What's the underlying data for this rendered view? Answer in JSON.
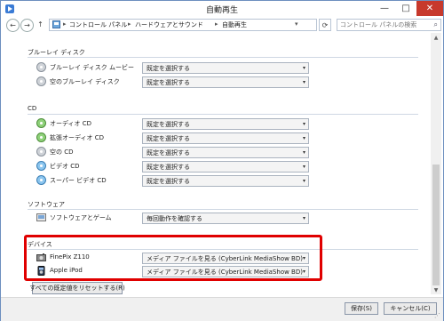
{
  "window": {
    "title": "自動再生"
  },
  "titlebar_buttons": {
    "min": "—",
    "max": "□",
    "close": "✕"
  },
  "nav": {
    "back": "←",
    "forward": "→",
    "up": "↑",
    "breadcrumbs": [
      "コントロール パネル",
      "ハードウェアとサウンド",
      "自動再生"
    ],
    "refresh": "⟳",
    "search_placeholder": "コントロール パネルの検索",
    "search_icon": "⌕"
  },
  "sections": {
    "bluray": {
      "title": "ブルーレイ ディスク",
      "items": [
        {
          "label": "ブルーレイ ディスク ムービー",
          "value": "既定を選択する",
          "icon": "disc-icon"
        },
        {
          "label": "空のブルーレイ ディスク",
          "value": "既定を選択する",
          "icon": "disc-icon"
        }
      ]
    },
    "cd": {
      "title": "CD",
      "items": [
        {
          "label": "オーディオ CD",
          "value": "既定を選択する",
          "icon": "audio-cd-icon"
        },
        {
          "label": "拡張オーディオ CD",
          "value": "既定を選択する",
          "icon": "audio-cd-icon"
        },
        {
          "label": "空の CD",
          "value": "既定を選択する",
          "icon": "disc-icon"
        },
        {
          "label": "ビデオ CD",
          "value": "既定を選択する",
          "icon": "video-cd-icon"
        },
        {
          "label": "スーパー ビデオ CD",
          "value": "既定を選択する",
          "icon": "video-cd-icon"
        }
      ]
    },
    "software": {
      "title": "ソフトウェア",
      "items": [
        {
          "label": "ソフトウェアとゲーム",
          "value": "毎回動作を確認する",
          "icon": "software-icon"
        }
      ]
    },
    "devices": {
      "title": "デバイス",
      "items": [
        {
          "label": "FinePix Z110",
          "value": "メディア ファイルを見る (CyberLink MediaShow BD)",
          "icon": "camera-icon"
        },
        {
          "label": "Apple iPod",
          "value": "メディア ファイルを見る (CyberLink MediaShow BD)",
          "icon": "ipod-icon"
        }
      ]
    }
  },
  "reset_button": "すべての既定値をリセットする(R)",
  "save_button": "保存(S)",
  "cancel_button": "キャンセル(C)",
  "caret": "▾",
  "colors": {
    "highlight": "#e00000",
    "close": "#c7392c"
  }
}
